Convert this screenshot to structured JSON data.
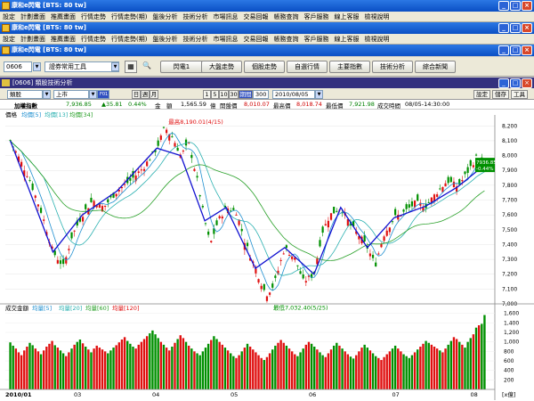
{
  "windows": [
    {
      "title": "康和e閃電 [BTS: 80 tw]"
    },
    {
      "title": "康和e閃電 [BTS: 80 tw]"
    },
    {
      "title": "康和e閃電 [BTS: 80 tw]"
    }
  ],
  "menu_items": [
    "設定",
    "計劃畫面",
    "推薦畫面",
    "行情走勢",
    "行情走勢(期)",
    "盤後分析",
    "技術分析",
    "市場訊息",
    "交易回報",
    "帳務查詢",
    "客戶服務",
    "線上客服",
    "檢視說明"
  ],
  "menu2_items": [
    "設定",
    "計劃畫面",
    "推薦畫面",
    "行情走勢",
    "行情走勢(期)",
    "盤後分析",
    "技術分析",
    "市場訊息",
    "交易回報",
    "帳務查詢",
    "客戶服務",
    "線上客服",
    "檢視說明"
  ],
  "toolbar": {
    "code": "0606",
    "group": "證券常用工具",
    "buttons": [
      "閃電1",
      "大盤走勢",
      "個股走勢",
      "自選行情",
      "主要指數",
      "技術分析",
      "綜合新聞"
    ]
  },
  "panel": {
    "title": "[0606] 類股技術分析",
    "category": "類股",
    "market": "上市",
    "period_label": "日",
    "period_options": [
      "日",
      "週",
      "月"
    ],
    "intervals": [
      "1",
      "5",
      "10",
      "30"
    ],
    "cycle_label": "期間",
    "cycle_value": "300",
    "date": "2010/08/05",
    "right_buttons": [
      "設定",
      "儲存",
      "工具"
    ]
  },
  "quote": {
    "name": "加權指數",
    "price": "7,936.85",
    "change": "▲35.81",
    "pct": "0.44%",
    "amount_label": "金　額",
    "amount": "1,565.59",
    "amount_unit": "億",
    "open_label": "開盤價",
    "open": "8,010.07",
    "high_label": "最高價",
    "high": "8,018.74",
    "low_label": "最低價",
    "low": "7,921.98",
    "time_label": "成交時間",
    "time": "08/05-14:30:00"
  },
  "chart": {
    "legend": "價格",
    "ma": [
      "均價[5]",
      "均價[13]",
      "均價[34]"
    ],
    "high_note": "最高8,190.01(4/15)",
    "low_note": "最低7,032.40(5/25)",
    "last_price": "7936.85",
    "last_change": "-0.44%",
    "vol_legend": "成交金額",
    "vol_ma": [
      "均量[5]",
      "均量[20]",
      "均量[60]",
      "均量[120]"
    ],
    "unit": "[x億]",
    "x_labels": [
      "2010/01",
      "03",
      "04",
      "05",
      "06",
      "07",
      "08"
    ],
    "colors": {
      "up": "#e01010",
      "down": "#009000",
      "ma5": "#1f8fd0",
      "ma13": "#2ab0b0",
      "ma34": "#28a028",
      "trend": "#1010d0"
    }
  },
  "chart_data": [
    {
      "type": "candlestick",
      "title": "加權指數",
      "ylim": [
        7000,
        8250
      ],
      "yticks": [
        7000,
        7100,
        7200,
        7300,
        7400,
        7500,
        7600,
        7700,
        7800,
        7900,
        8000,
        8100,
        8200
      ],
      "x_labels": [
        "2010/01",
        "03",
        "04",
        "05",
        "06",
        "07",
        "08"
      ],
      "close_path": [
        [
          0,
          8100
        ],
        [
          7,
          7850
        ],
        [
          12,
          7600
        ],
        [
          16,
          7350
        ],
        [
          20,
          7250
        ],
        [
          23,
          7450
        ],
        [
          27,
          7600
        ],
        [
          31,
          7700
        ],
        [
          35,
          7650
        ],
        [
          40,
          7760
        ],
        [
          45,
          7830
        ],
        [
          50,
          7920
        ],
        [
          55,
          8050
        ],
        [
          58,
          8190
        ],
        [
          61,
          8120
        ],
        [
          64,
          8000
        ],
        [
          67,
          8080
        ],
        [
          70,
          7850
        ],
        [
          73,
          7560
        ],
        [
          75,
          7400
        ],
        [
          78,
          7560
        ],
        [
          81,
          7650
        ],
        [
          85,
          7620
        ],
        [
          88,
          7420
        ],
        [
          92,
          7240
        ],
        [
          96,
          7060
        ],
        [
          99,
          7130
        ],
        [
          103,
          7380
        ],
        [
          107,
          7300
        ],
        [
          110,
          7150
        ],
        [
          114,
          7200
        ],
        [
          117,
          7480
        ],
        [
          120,
          7600
        ],
        [
          124,
          7650
        ],
        [
          128,
          7520
        ],
        [
          131,
          7460
        ],
        [
          134,
          7380
        ],
        [
          137,
          7260
        ],
        [
          140,
          7460
        ],
        [
          144,
          7580
        ],
        [
          148,
          7620
        ],
        [
          152,
          7680
        ],
        [
          156,
          7660
        ],
        [
          160,
          7750
        ],
        [
          164,
          7830
        ],
        [
          168,
          7790
        ],
        [
          172,
          7900
        ],
        [
          175,
          7990
        ],
        [
          178,
          7936.85
        ]
      ],
      "annotations": [
        "最高8,190.01(4/15)",
        "最低7,032.40(5/25)"
      ]
    },
    {
      "type": "bar",
      "title": "成交金額",
      "ylim": [
        0,
        1650
      ],
      "yticks": [
        200,
        400,
        600,
        800,
        1000,
        1200,
        1400,
        1600
      ],
      "unit": "億",
      "values": [
        990,
        920,
        860,
        780,
        720,
        820,
        900,
        980,
        930,
        860,
        800,
        740,
        820,
        900,
        960,
        1020,
        930,
        880,
        820,
        760,
        700,
        780,
        860,
        940,
        1000,
        1050,
        970,
        900,
        840,
        780,
        860,
        920,
        880,
        840,
        800,
        760,
        820,
        880,
        930,
        990,
        1050,
        1100,
        1020,
        960,
        900,
        860,
        940,
        1000,
        1060,
        1120,
        1180,
        1240,
        1160,
        1080,
        1000,
        940,
        880,
        820,
        900,
        980,
        1060,
        1140,
        1080,
        1000,
        920,
        860,
        800,
        760,
        720,
        800,
        880,
        960,
        1040,
        1120,
        1060,
        1000,
        940,
        880,
        820,
        760,
        700,
        660,
        720,
        800,
        880,
        960,
        900,
        840,
        780,
        720,
        660,
        620,
        680,
        760,
        840,
        920,
        980,
        1040,
        980,
        920,
        860,
        800,
        740,
        700,
        780,
        860,
        940,
        1000,
        960,
        900,
        840,
        780,
        720,
        680,
        760,
        840,
        920,
        980,
        920,
        860,
        800,
        740,
        690,
        650,
        720,
        800,
        880,
        940,
        880,
        820,
        760,
        700,
        660,
        620,
        680,
        740,
        800,
        860,
        920,
        860,
        800,
        740,
        700,
        660,
        720,
        780,
        840,
        900,
        960,
        1020,
        980,
        940,
        900,
        860,
        820,
        780,
        860,
        940,
        1020,
        1100,
        1060,
        1000,
        940,
        880,
        1000,
        1080,
        1160,
        1300,
        1350,
        1380,
        1565.59
      ]
    }
  ]
}
